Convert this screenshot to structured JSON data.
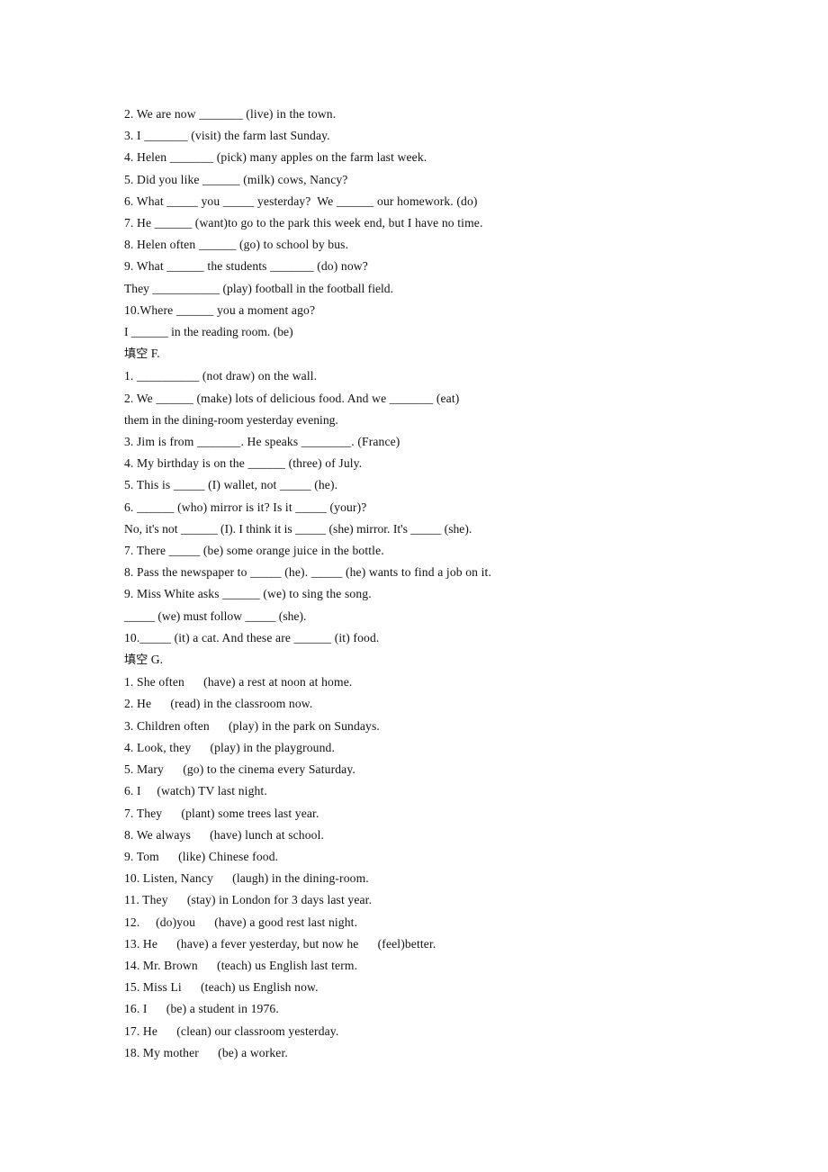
{
  "document": {
    "type": "english-grammar-worksheet",
    "language_note": "填空",
    "sections": [
      {
        "id": "section-continued",
        "heading": null,
        "blank_style": "underscore",
        "lines": [
          {
            "id": "c-2",
            "text": "2. We are now _______ (live) in the town."
          },
          {
            "id": "c-3",
            "text": "3. I _______ (visit) the farm last Sunday."
          },
          {
            "id": "c-4",
            "text": "4. Helen _______ (pick) many apples on the farm last week."
          },
          {
            "id": "c-5",
            "text": "5. Did you like ______ (milk) cows, Nancy?"
          },
          {
            "id": "c-6",
            "text": "6. What _____ you _____ yesterday?  We ______ our homework. (do)"
          },
          {
            "id": "c-7",
            "text": "7. He ______ (want)to go to the park this week end, but I have no time."
          },
          {
            "id": "c-8",
            "text": "8. Helen often ______ (go) to school by bus."
          },
          {
            "id": "c-9",
            "text": "9. What ______ the students _______ (do) now?"
          },
          {
            "id": "c-9b",
            "text": "They ___________ (play) football in the football field.",
            "continuation": true
          },
          {
            "id": "c-10",
            "text": "10.Where ______ you a moment ago?"
          },
          {
            "id": "c-10b",
            "text": "I ______ in the reading room. (be)",
            "continuation": true
          }
        ]
      },
      {
        "id": "section-f",
        "heading": {
          "cjk": "填空",
          "label": " F."
        },
        "blank_style": "underscore",
        "lines": [
          {
            "id": "f-1",
            "text": "1. __________ (not draw) on the wall."
          },
          {
            "id": "f-2",
            "text": "2. We ______ (make) lots of delicious food. And we _______ (eat)"
          },
          {
            "id": "f-2b",
            "text": "them in the dining-room yesterday evening.",
            "continuation": true
          },
          {
            "id": "f-3",
            "text": "3. Jim is from _______. He speaks ________. (France)"
          },
          {
            "id": "f-4",
            "text": "4. My birthday is on the ______ (three) of July."
          },
          {
            "id": "f-5",
            "text": "5. This is _____ (I) wallet, not _____ (he)."
          },
          {
            "id": "f-6",
            "text": "6. ______ (who) mirror is it? Is it _____ (your)?"
          },
          {
            "id": "f-6b",
            "text": "No, it's not ______ (I). I think it is _____ (she) mirror. It's _____ (she).",
            "continuation": true
          },
          {
            "id": "f-7",
            "text": "7. There _____ (be) some orange juice in the bottle."
          },
          {
            "id": "f-8",
            "text": "8. Pass the newspaper to _____ (he). _____ (he) wants to find a job on it."
          },
          {
            "id": "f-9",
            "text": "9. Miss White asks ______ (we) to sing the song."
          },
          {
            "id": "f-9b",
            "text": "_____ (we) must follow _____ (she).",
            "continuation": true
          },
          {
            "id": "f-10",
            "text": "10._____ (it) a cat. And these are ______ (it) food."
          }
        ]
      },
      {
        "id": "section-g",
        "heading": {
          "cjk": "填空",
          "label": " G."
        },
        "blank_style": "space-gap",
        "lines": [
          {
            "id": "g-1",
            "text": "1. She often      (have) a rest at noon at home."
          },
          {
            "id": "g-2",
            "text": "2. He      (read) in the classroom now."
          },
          {
            "id": "g-3",
            "text": "3. Children often      (play) in the park on Sundays."
          },
          {
            "id": "g-4",
            "text": "4. Look, they      (play) in the playground."
          },
          {
            "id": "g-5",
            "text": "5. Mary      (go) to the cinema every Saturday."
          },
          {
            "id": "g-6",
            "text": "6. I     (watch) TV last night."
          },
          {
            "id": "g-7",
            "text": "7. They      (plant) some trees last year."
          },
          {
            "id": "g-8",
            "text": "8. We always      (have) lunch at school."
          },
          {
            "id": "g-9",
            "text": "9. Tom      (like) Chinese food."
          },
          {
            "id": "g-10",
            "text": "10. Listen, Nancy      (laugh) in the dining-room."
          },
          {
            "id": "g-11",
            "text": "11. They      (stay) in London for 3 days last year."
          },
          {
            "id": "g-12",
            "text": "12.     (do)you      (have) a good rest last night."
          },
          {
            "id": "g-13",
            "text": "13. He      (have) a fever yesterday, but now he      (feel)better."
          },
          {
            "id": "g-14",
            "text": "14. Mr. Brown      (teach) us English last term."
          },
          {
            "id": "g-15",
            "text": "15. Miss Li      (teach) us English now."
          },
          {
            "id": "g-16",
            "text": "16. I      (be) a student in 1976."
          },
          {
            "id": "g-17",
            "text": "17. He      (clean) our classroom yesterday."
          },
          {
            "id": "g-18",
            "text": "18. My mother      (be) a worker."
          }
        ]
      }
    ]
  }
}
